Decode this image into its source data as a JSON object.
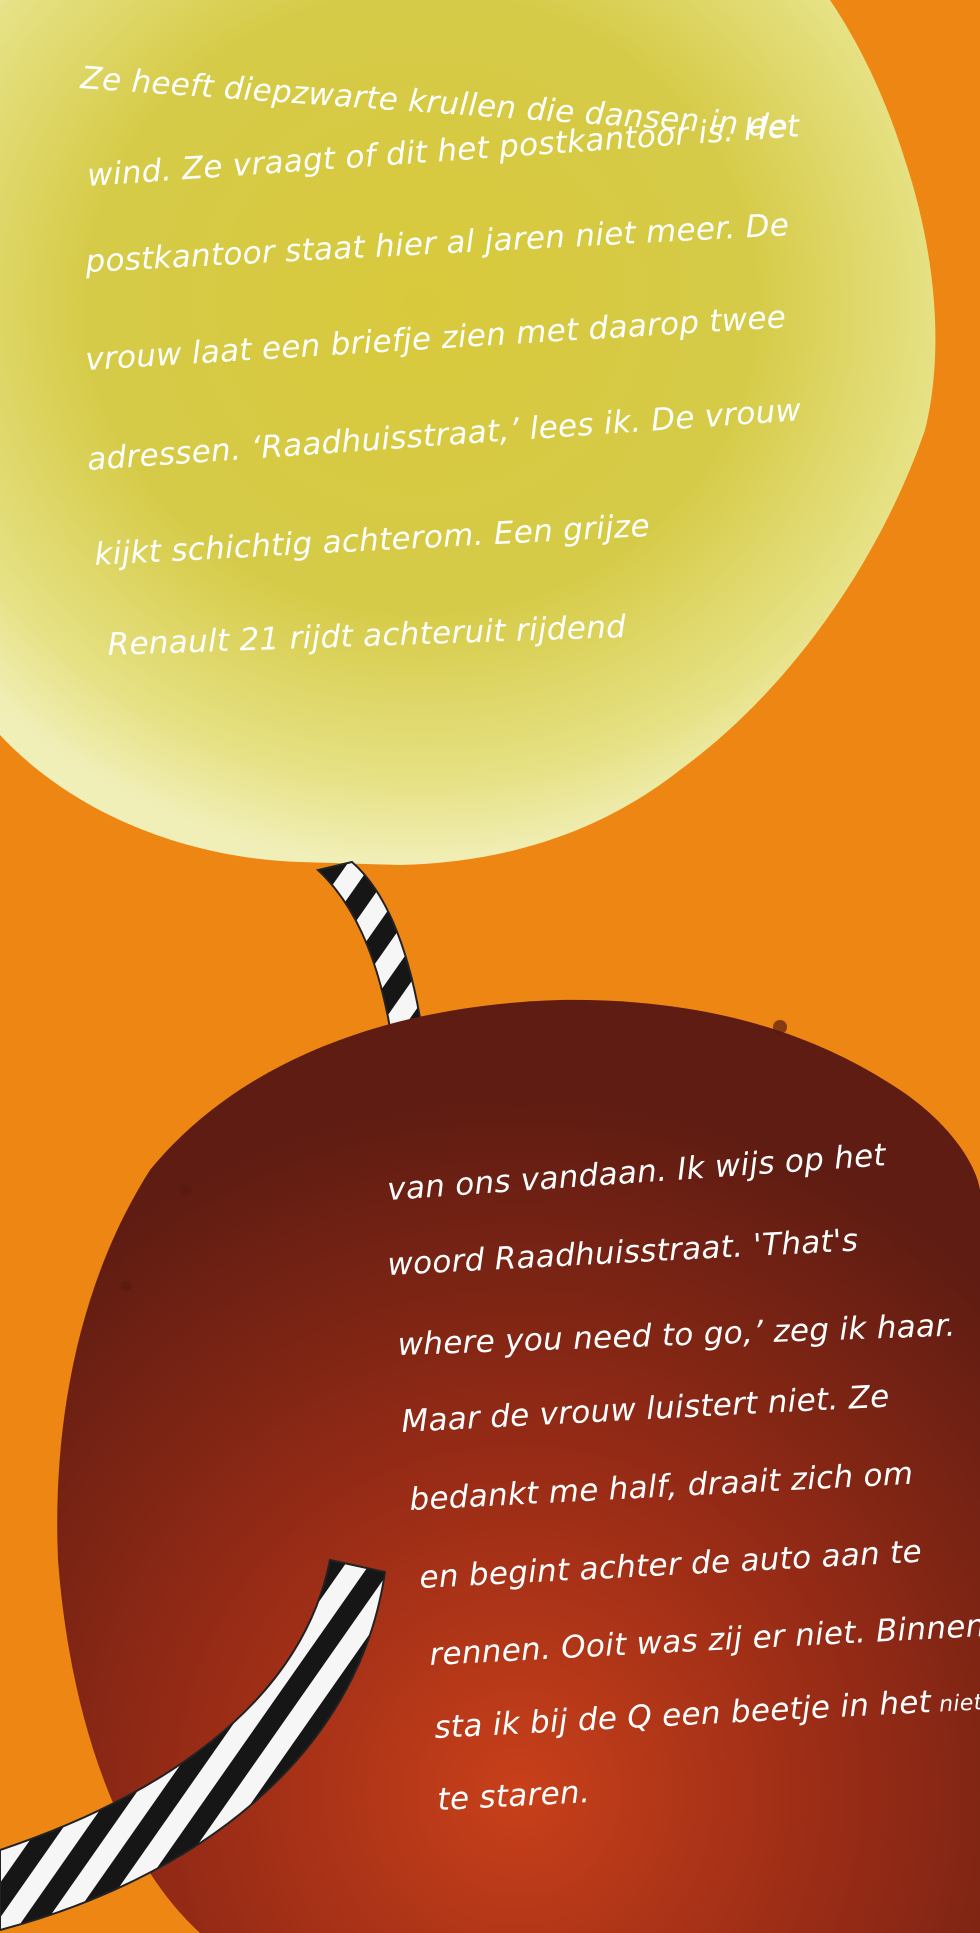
{
  "colors": {
    "background": "#ee8614",
    "upper_plate": "#e2d24a",
    "lower_plate": "#8a2a14",
    "text": "#ffffff",
    "handle_dark": "#1a1a1a",
    "handle_light": "#f4f4f4"
  },
  "poem": {
    "top": [
      "Ze heeft diepzwarte krullen die dansen in de",
      "wind. Ze vraagt of dit het postkantoor is. Het",
      "postkantoor staat hier al jaren niet meer. De",
      "vrouw laat een briefje zien met daarop twee",
      "adressen. ‘Raadhuisstraat,’ lees ik. De vrouw",
      "kijkt schichtig achterom. Een grijze",
      "Renault 21 rijdt achteruit rijdend"
    ],
    "bottom": [
      "van ons vandaan. Ik wijs op het",
      "woord Raadhuisstraat. 'That's",
      "where you need to go,’ zeg ik haar.",
      "Maar de vrouw luistert niet. Ze",
      "bedankt me half, draait zich om",
      "en begint achter de auto aan te",
      "rennen. Ooit was zij er niet. Binnen",
      "sta ik bij de Q een beetje in het",
      "te staren."
    ],
    "bottom_small_word": "niets"
  }
}
